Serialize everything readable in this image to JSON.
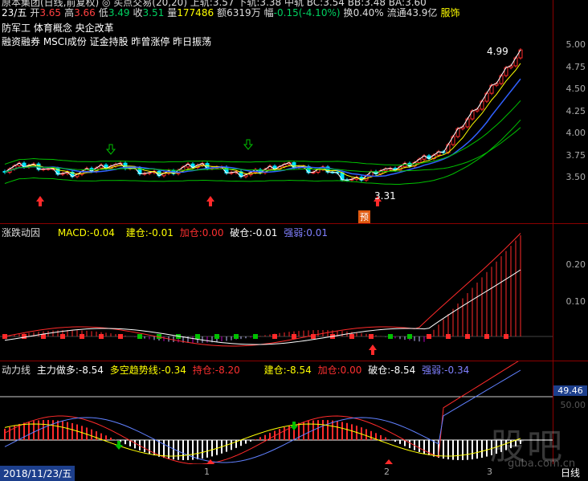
{
  "top": {
    "line1": "原本集团(日线,前复权)  ◎ 买点交易(20,20)  上轨:3.57  下轨:3.38  中轨  BC:3.54  BB:3.48  BA:3.60",
    "date_label": "23/五",
    "open_label": "开",
    "open_value": "3.65",
    "high_label": "高",
    "high_value": "3.66",
    "low_label": "低",
    "low_value": "3.49",
    "close_label": "收",
    "close_value": "3.51",
    "volume_label": "量",
    "volume_value": "177486",
    "amount_label": "额",
    "amount_value": "6319万",
    "change_label": "幅",
    "change_value": "-0.15(-4.10%)",
    "turnover_label": "换",
    "turnover_value": "0.40%",
    "float_label": "流通",
    "float_value": "43.9亿",
    "industry": "服饰",
    "concepts1": "防军工 体育概念 央企改革",
    "concepts2": "融资融券 MSCI成份 证金持股 昨曾涨停 昨日振荡"
  },
  "price_axis": [
    "5.00",
    "4.75",
    "4.50",
    "4.25",
    "4.00",
    "3.75",
    "3.50"
  ],
  "price_annotations": {
    "high": "4.99",
    "low": "3.31",
    "pre": "预"
  },
  "macd": {
    "title": "涨跌动因",
    "macd_label": "MACD:",
    "macd_value": "-0.04",
    "jc_label": "建仓:",
    "jc_value": "-0.01",
    "jia_label": "加仓:",
    "jia_value": "0.00",
    "po_label": "破仓:",
    "po_value": "-0.01",
    "qr_label": "强弱:",
    "qr_value": "0.01",
    "axis": [
      "0.20",
      "0.10"
    ]
  },
  "power": {
    "title": "动力线",
    "main_label": "主力做多:",
    "main_value": "-8.54",
    "trend_label": "多空趋势线:",
    "trend_value": "-0.34",
    "hold_label": "持仓:",
    "hold_value": "-8.20",
    "jc_label": "建仓:",
    "jc_value": "-8.54",
    "jia_label": "加仓:",
    "jia_value": "0.00",
    "po_label": "破仓:",
    "po_value": "-8.54",
    "qr_label": "强弱:",
    "qr_value": "-0.34",
    "axis_value": "49.46",
    "axis_faded": "50.00"
  },
  "footer": {
    "date": "2018/11/23/五",
    "marks": [
      "1",
      "2",
      "3"
    ],
    "period": "日线"
  },
  "watermark": {
    "main": "股吧",
    "sub": "guba.com.cn"
  },
  "colors": {
    "up": "#ff2a2a",
    "down": "#00e5ff",
    "green": "#00c000",
    "yellow": "#ffff00"
  }
}
